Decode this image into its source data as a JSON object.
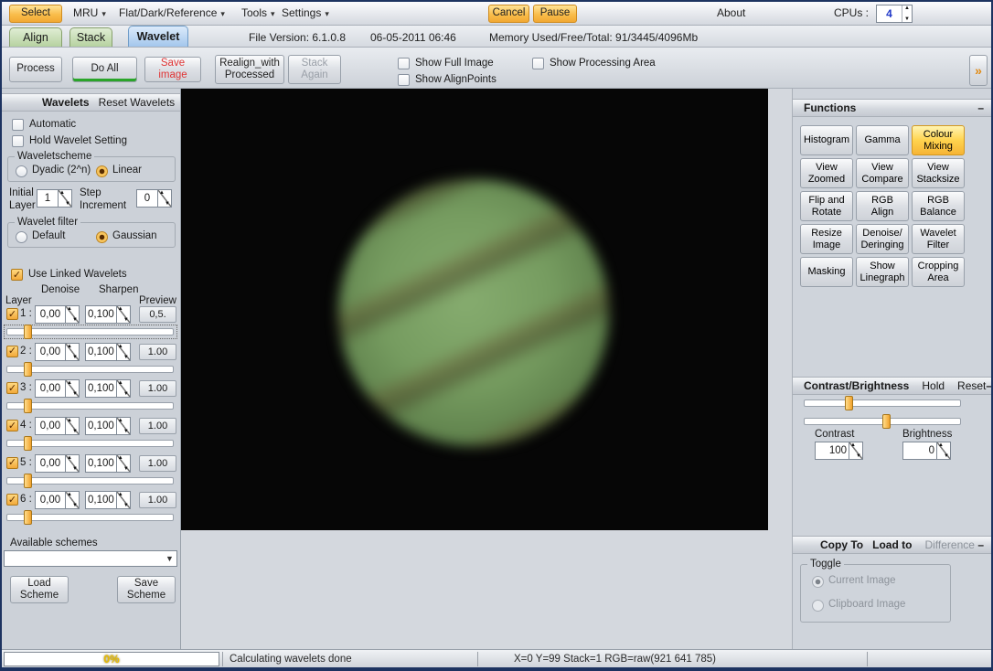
{
  "menubar": {
    "select": "Select",
    "mru": "MRU",
    "flat_dark_reference": "Flat/Dark/Reference",
    "tools": "Tools",
    "settings": "Settings",
    "cancel": "Cancel",
    "pause": "Pause",
    "about": "About",
    "cpus_label": "CPUs :",
    "cpus_value": "4"
  },
  "tabbar": {
    "align": "Align",
    "stack": "Stack",
    "wavelet": "Wavelet",
    "file_version": "File Version: 6.1.0.8",
    "datetime": "06-05-2011 06:46",
    "memory": "Memory Used/Free/Total: 91/3445/4096Mb"
  },
  "toolbar": {
    "process": "Process",
    "do_all": "Do All",
    "save_image": "Save image",
    "realign": "Realign_with\nProcessed",
    "stack_again": "Stack Again",
    "show_full_image": "Show Full Image",
    "show_alignpoints": "Show AlignPoints",
    "show_processing_area": "Show Processing Area",
    "expand": "»"
  },
  "wavelets": {
    "title": "Wavelets",
    "reset": "Reset Wavelets",
    "automatic": "Automatic",
    "hold_setting": "Hold Wavelet Setting",
    "scheme_group": "Waveletscheme",
    "scheme_dyadic": "Dyadic (2^n)",
    "scheme_linear": "Linear",
    "initial_layer_label": "Initial\nLayer",
    "initial_layer_value": "1",
    "step_increment_label": "Step\nIncrement",
    "step_increment_value": "0",
    "filter_group": "Wavelet filter",
    "filter_default": "Default",
    "filter_gaussian": "Gaussian",
    "use_linked": "Use Linked Wavelets",
    "col_layer": "Layer",
    "col_denoise": "Denoise",
    "col_sharpen": "Sharpen",
    "col_preview": "Preview",
    "layers": [
      {
        "label": "1 :",
        "denoise": "0,00",
        "sharpen": "0,100",
        "preview": "0,5."
      },
      {
        "label": "2 :",
        "denoise": "0,00",
        "sharpen": "0,100",
        "preview": "1.00"
      },
      {
        "label": "3 :",
        "denoise": "0,00",
        "sharpen": "0,100",
        "preview": "1.00"
      },
      {
        "label": "4 :",
        "denoise": "0,00",
        "sharpen": "0,100",
        "preview": "1.00"
      },
      {
        "label": "5 :",
        "denoise": "0,00",
        "sharpen": "0,100",
        "preview": "1.00"
      },
      {
        "label": "6 :",
        "denoise": "0,00",
        "sharpen": "0,100",
        "preview": "1.00"
      }
    ],
    "available_schemes": "Available schemes",
    "load_scheme": "Load\nScheme",
    "save_scheme": "Save\nScheme"
  },
  "functions": {
    "title": "Functions",
    "minimize": "–",
    "buttons": [
      "Histogram",
      "Gamma",
      "Colour\nMixing",
      "View\nZoomed",
      "View\nCompare",
      "View\nStacksize",
      "Flip and\nRotate",
      "RGB\nAlign",
      "RGB\nBalance",
      "Resize\nImage",
      "Denoise/\nDeringing",
      "Wavelet\nFilter",
      "Masking",
      "Show\nLinegraph",
      "Cropping\nArea"
    ],
    "active_button": "Colour Mixing"
  },
  "contrast": {
    "title": "Contrast/Brightness",
    "hold": "Hold",
    "reset": "Reset",
    "minimize": "–",
    "contrast_label": "Contrast",
    "contrast_value": "100",
    "brightness_label": "Brightness",
    "brightness_value": "0"
  },
  "copy_panel": {
    "copy_to": "Copy To",
    "load_to": "Load to",
    "difference": "Difference",
    "minimize": "–",
    "toggle": "Toggle",
    "current_image": "Current Image",
    "clipboard_image": "Clipboard Image"
  },
  "statusbar": {
    "progress": "0%",
    "message": "Calculating wavelets done",
    "coords": "X=0 Y=99 Stack=1 RGB=raw(921 641 785)"
  },
  "icons": {
    "dropdown_arrow": "▾",
    "combo_arrow": "▼",
    "spinner_up": "▲",
    "spinner_down": "▼",
    "expand": "»",
    "check": "✓",
    "minimize": "–"
  },
  "colors": {
    "accent_amber": "#f6b73c",
    "tab_active_blue": "#a3c6ec",
    "tab_green": "#b6d2a0",
    "save_image_red": "#e03535",
    "cpu_value_blue": "#2038c8",
    "progress_yellow": "#e8bb00",
    "do_all_green": "#2aa52a",
    "jupiter_green": "#769c60",
    "jupiter_band": "#4a5c42",
    "panel_grey": "#ccd1d8",
    "image_background": "#060606"
  }
}
